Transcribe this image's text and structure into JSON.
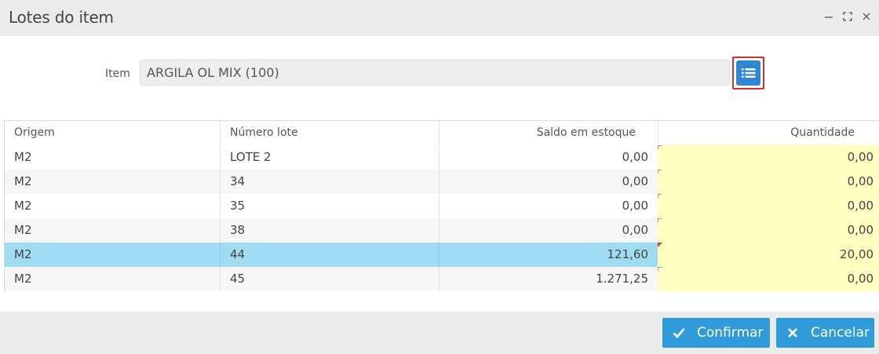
{
  "window": {
    "title": "Lotes do item",
    "controls": [
      "minimize-icon",
      "maximize-icon",
      "close-icon"
    ]
  },
  "item": {
    "label": "Item",
    "value": "ARGILA OL MIX (100)",
    "list_button_icon": "list-icon"
  },
  "grid": {
    "columns": [
      "Origem",
      "Número lote",
      "Saldo em estoque",
      "Quantidade"
    ],
    "rows": [
      {
        "origem": "M2",
        "lote": "LOTE 2",
        "saldo": "0,00",
        "quantidade": "0,00",
        "selected": false,
        "edited": false
      },
      {
        "origem": "M2",
        "lote": "34",
        "saldo": "0,00",
        "quantidade": "0,00",
        "selected": false,
        "edited": false
      },
      {
        "origem": "M2",
        "lote": "35",
        "saldo": "0,00",
        "quantidade": "0,00",
        "selected": false,
        "edited": false
      },
      {
        "origem": "M2",
        "lote": "38",
        "saldo": "0,00",
        "quantidade": "0,00",
        "selected": false,
        "edited": false
      },
      {
        "origem": "M2",
        "lote": "44",
        "saldo": "121,60",
        "quantidade": "20,00",
        "selected": true,
        "edited": true
      },
      {
        "origem": "M2",
        "lote": "45",
        "saldo": "1.271,25",
        "quantidade": "0,00",
        "selected": false,
        "edited": false
      }
    ]
  },
  "footer": {
    "confirm_label": "Confirmar",
    "cancel_label": "Cancelar",
    "confirm_icon": "check-icon",
    "cancel_icon": "close-icon"
  },
  "colors": {
    "primary_button": "#2f9bd9",
    "list_button": "#2f86d4",
    "highlight_border": "#d0312d",
    "selected_row": "#9fdcf2",
    "editable_cell": "#ffffc2"
  }
}
